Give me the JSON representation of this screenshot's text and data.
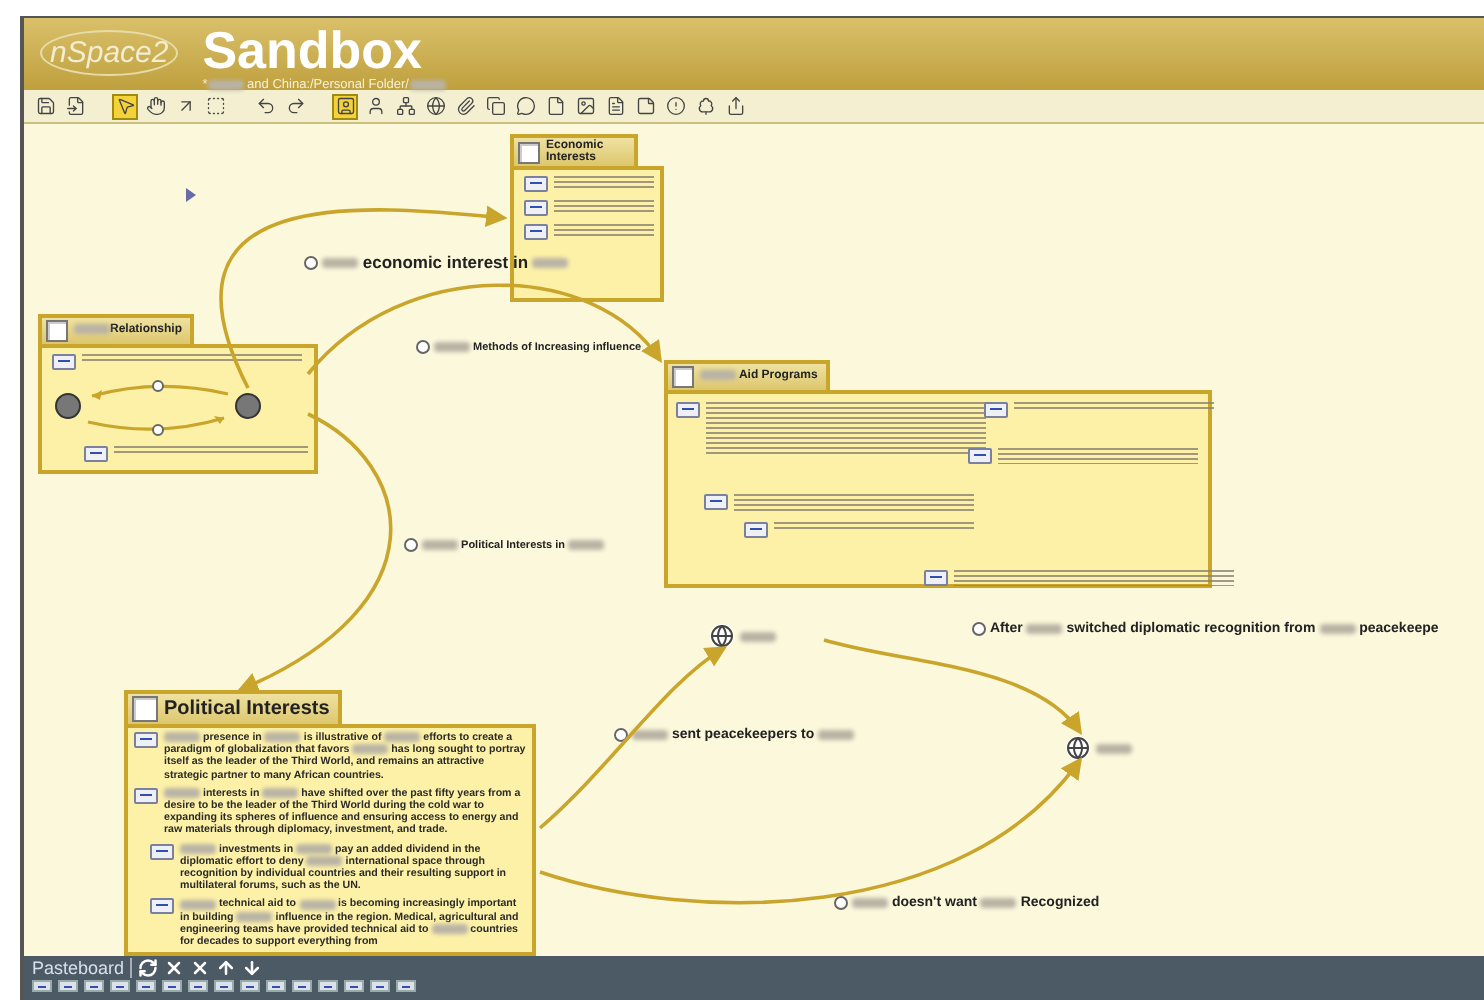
{
  "app": {
    "logo": "nSpace2",
    "title": "Sandbox",
    "path": [
      {
        "text": "*"
      },
      {
        "kind": "blur"
      },
      {
        "text": " and China:/Personal Folder/"
      },
      {
        "kind": "blur"
      }
    ]
  },
  "toolbar": [
    {
      "kind": "save",
      "selected": false
    },
    {
      "kind": "import",
      "selected": false
    },
    {
      "kind": "pointer",
      "selected": true
    },
    {
      "kind": "hand",
      "selected": false
    },
    {
      "kind": "arrow",
      "selected": false
    },
    {
      "kind": "frame",
      "selected": false
    },
    {
      "kind": "undo",
      "selected": false
    },
    {
      "kind": "redo",
      "selected": false
    },
    {
      "kind": "entity",
      "selected": true
    },
    {
      "kind": "person",
      "selected": false
    },
    {
      "kind": "hierarchy",
      "selected": false
    },
    {
      "kind": "globe",
      "selected": false
    },
    {
      "kind": "clip",
      "selected": false
    },
    {
      "kind": "copy",
      "selected": false
    },
    {
      "kind": "comment",
      "selected": false
    },
    {
      "kind": "page",
      "selected": false
    },
    {
      "kind": "image",
      "selected": false
    },
    {
      "kind": "list",
      "selected": false
    },
    {
      "kind": "note",
      "selected": false
    },
    {
      "kind": "alert",
      "selected": false
    },
    {
      "kind": "tree",
      "selected": false
    },
    {
      "kind": "export",
      "selected": false
    }
  ],
  "frames": [
    {
      "title": [
        {
          "text": "Economic Interests"
        }
      ],
      "items": [
        {
          "kind": "note"
        },
        {
          "kind": "note"
        },
        {
          "kind": "note"
        }
      ]
    },
    {
      "title": [
        {
          "kind": "blur"
        },
        {
          "text": "Relationship"
        }
      ],
      "items": [
        {
          "kind": "note"
        },
        {
          "kind": "diagram"
        },
        {
          "kind": "note"
        }
      ]
    },
    {
      "title": [
        {
          "kind": "blur"
        },
        {
          "text": " Aid Programs"
        }
      ],
      "items": [
        {
          "kind": "note"
        },
        {
          "kind": "note"
        },
        {
          "kind": "note"
        },
        {
          "kind": "note"
        },
        {
          "kind": "note"
        },
        {
          "kind": "note"
        }
      ]
    },
    {
      "title": [
        {
          "text": "Political Interests"
        }
      ],
      "items": [
        {
          "kind": "text",
          "segments": [
            {
              "kind": "blur"
            },
            {
              "text": " presence in "
            },
            {
              "kind": "blur"
            },
            {
              "text": " is illustrative of "
            },
            {
              "kind": "blur"
            },
            {
              "text": " efforts to create a paradigm of globalization that favors "
            },
            {
              "kind": "blur"
            },
            {
              "text": " has long sought to portray itself as the leader of the Third World, and remains an attractive strategic partner to many African countries."
            }
          ]
        },
        {
          "kind": "text",
          "segments": [
            {
              "kind": "blur"
            },
            {
              "text": " interests in "
            },
            {
              "kind": "blur"
            },
            {
              "text": " have shifted over the past fifty years from a desire to be the leader of the Third World during the cold war to expanding its spheres of influence and ensuring access to energy and raw materials through diplomacy, investment, and trade."
            }
          ]
        },
        {
          "kind": "text",
          "segments": [
            {
              "kind": "blur"
            },
            {
              "text": " investments in "
            },
            {
              "kind": "blur"
            },
            {
              "text": " pay an added dividend in the diplomatic effort to deny "
            },
            {
              "kind": "blur"
            },
            {
              "text": " international space through recognition by individual countries and their resulting support in multilateral forums, such as the UN."
            }
          ]
        },
        {
          "kind": "text",
          "segments": [
            {
              "kind": "blur"
            },
            {
              "text": " technical aid to "
            },
            {
              "kind": "blur"
            },
            {
              "text": " is becoming increasingly important in building "
            },
            {
              "kind": "blur"
            },
            {
              "text": " influence in the region. Medical, agricultural and engineering teams have provided technical aid to "
            },
            {
              "kind": "blur"
            },
            {
              "text": " countries for decades to support everything from"
            }
          ]
        }
      ]
    }
  ],
  "places": [
    {
      "label": [
        {
          "kind": "blur"
        }
      ]
    },
    {
      "label": [
        {
          "kind": "blur"
        }
      ]
    }
  ],
  "links": [
    {
      "kind": "large",
      "label": [
        {
          "kind": "blur"
        },
        {
          "text": " economic interest in "
        },
        {
          "kind": "blur"
        }
      ]
    },
    {
      "kind": "small",
      "label": [
        {
          "kind": "blur"
        },
        {
          "text": " Methods of Increasing influence"
        }
      ]
    },
    {
      "kind": "small",
      "label": [
        {
          "kind": "blur"
        },
        {
          "text": " Political Interests in "
        },
        {
          "kind": "blur"
        }
      ]
    },
    {
      "kind": "medium",
      "label": [
        {
          "kind": "blur"
        },
        {
          "text": " sent peacekeepers to "
        },
        {
          "kind": "blur"
        }
      ]
    },
    {
      "kind": "medium",
      "label": [
        {
          "text": "After "
        },
        {
          "kind": "blur"
        },
        {
          "text": " switched diplomatic recognition from "
        },
        {
          "kind": "blur"
        },
        {
          "text": " peacekeepe"
        }
      ]
    },
    {
      "kind": "medium",
      "label": [
        {
          "kind": "blur"
        },
        {
          "text": " doesn't want "
        },
        {
          "kind": "blur"
        },
        {
          "text": " Recognized"
        }
      ]
    }
  ],
  "pasteboard": {
    "label": "Pasteboard",
    "actions": [
      {
        "kind": "refresh"
      },
      {
        "kind": "clear"
      },
      {
        "kind": "delete"
      },
      {
        "kind": "up"
      },
      {
        "kind": "down"
      }
    ],
    "items": [
      {
        "kind": "note"
      },
      {
        "kind": "note"
      },
      {
        "kind": "note"
      },
      {
        "kind": "note"
      },
      {
        "kind": "note"
      },
      {
        "kind": "note"
      },
      {
        "kind": "note"
      },
      {
        "kind": "note"
      },
      {
        "kind": "note"
      },
      {
        "kind": "note"
      },
      {
        "kind": "note"
      },
      {
        "kind": "note"
      },
      {
        "kind": "note"
      },
      {
        "kind": "note"
      },
      {
        "kind": "note"
      }
    ]
  }
}
